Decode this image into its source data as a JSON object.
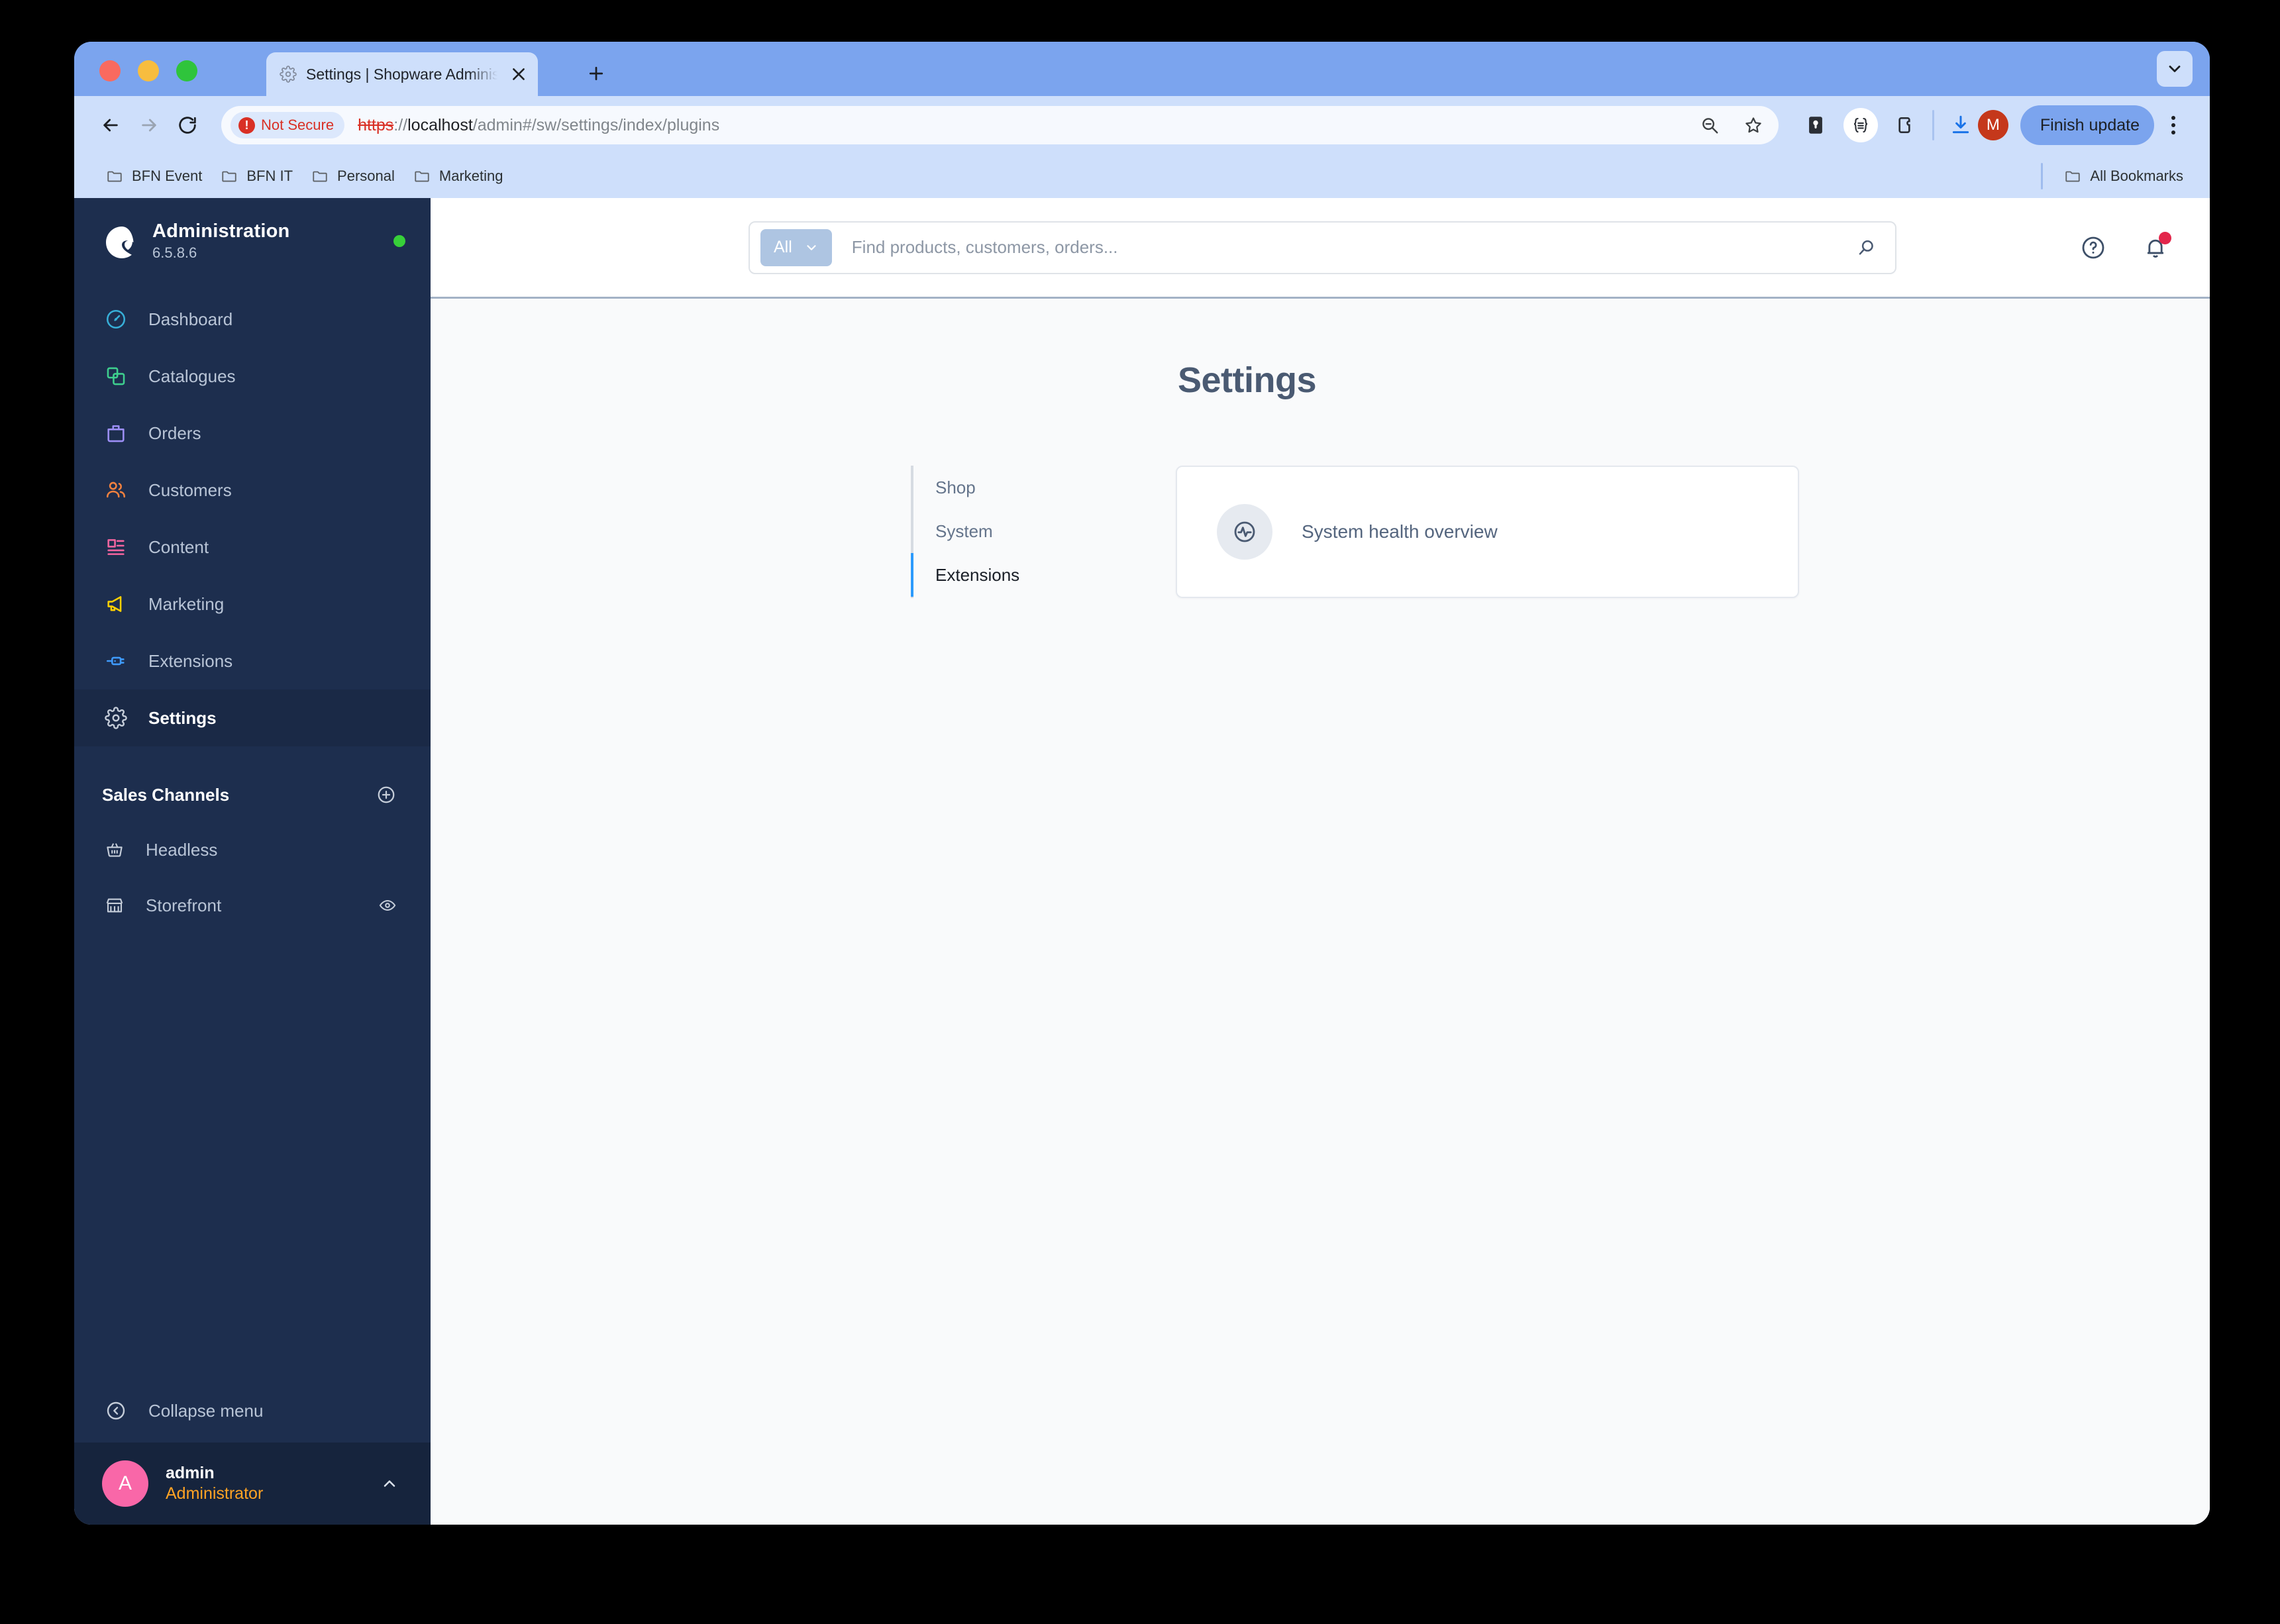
{
  "browser": {
    "tab": {
      "title": "Settings | Shopware Administ",
      "favicon_icon": "gear-icon",
      "close_icon": "close-icon"
    },
    "new_tab_icon": "plus-icon",
    "window_chevron_icon": "chevron-down-icon",
    "nav": {
      "back_icon": "arrow-left-icon",
      "forward_icon": "arrow-right-icon",
      "reload_icon": "reload-icon"
    },
    "omnibox": {
      "security_label": "Not Secure",
      "security_icon": "not-secure-icon",
      "url_scheme": "https",
      "url_separator": "://",
      "url_host": "localhost",
      "url_path": "/admin#/sw/settings/index/plugins",
      "zoom_icon": "zoom-out-icon",
      "bookmark_icon": "star-icon"
    },
    "extensions": [
      {
        "name": "extension-shield-icon"
      },
      {
        "name": "json-viewer-icon"
      },
      {
        "name": "extensions-puzzle-icon"
      }
    ],
    "downloads_icon": "download-icon",
    "profile_initial": "M",
    "update_button_label": "Finish update",
    "menu_icon": "kebab-menu-icon",
    "bookmarks": [
      {
        "label": "BFN Event",
        "icon": "folder-icon"
      },
      {
        "label": "BFN IT",
        "icon": "folder-icon"
      },
      {
        "label": "Personal",
        "icon": "folder-icon"
      },
      {
        "label": "Marketing",
        "icon": "folder-icon"
      }
    ],
    "all_bookmarks_label": "All Bookmarks",
    "all_bookmarks_icon": "folder-icon"
  },
  "sidebar": {
    "app_title": "Administration",
    "version": "6.5.8.6",
    "status_color": "#37d039",
    "logo_icon": "shopware-logo-icon",
    "nav": [
      {
        "label": "Dashboard",
        "icon": "dashboard-icon",
        "color": "#37afd8",
        "active": false
      },
      {
        "label": "Catalogues",
        "icon": "catalogues-icon",
        "color": "#3ecf8e",
        "active": false
      },
      {
        "label": "Orders",
        "icon": "orders-icon",
        "color": "#9d8ff7",
        "active": false
      },
      {
        "label": "Customers",
        "icon": "customers-icon",
        "color": "#f2813f",
        "active": false
      },
      {
        "label": "Content",
        "icon": "content-icon",
        "color": "#f765a0",
        "active": false
      },
      {
        "label": "Marketing",
        "icon": "marketing-icon",
        "color": "#ffd000",
        "active": false
      },
      {
        "label": "Extensions",
        "icon": "extensions-icon",
        "color": "#3f9bfd",
        "active": false
      },
      {
        "label": "Settings",
        "icon": "settings-gear-icon",
        "color": "#c5cdd9",
        "active": true
      }
    ],
    "sales_channels": {
      "title": "Sales Channels",
      "add_icon": "plus-circle-icon",
      "items": [
        {
          "label": "Headless",
          "icon": "basket-icon",
          "eye": false
        },
        {
          "label": "Storefront",
          "icon": "storefront-icon",
          "eye": true,
          "eye_icon": "eye-icon"
        }
      ]
    },
    "collapse": {
      "label": "Collapse menu",
      "icon": "collapse-left-icon"
    },
    "user": {
      "initial": "A",
      "name": "admin",
      "role": "Administrator",
      "chevron_icon": "chevron-up-icon",
      "avatar_color": "#f967a8",
      "role_color": "#ffa324"
    }
  },
  "topbar": {
    "search_scope": "All",
    "search_scope_chevron_icon": "chevron-down-icon",
    "search_placeholder": "Find products, customers, orders...",
    "search_value": "",
    "search_icon": "search-icon",
    "help_icon": "help-circle-icon",
    "notifications_icon": "bell-icon",
    "notification_badge_color": "#e3264b"
  },
  "page": {
    "title": "Settings",
    "tabs": [
      {
        "label": "Shop",
        "active": false
      },
      {
        "label": "System",
        "active": false
      },
      {
        "label": "Extensions",
        "active": true
      }
    ],
    "cards": [
      {
        "label": "System health overview",
        "icon": "activity-pulse-icon"
      }
    ],
    "active_tab_color": "#2b9afc"
  }
}
